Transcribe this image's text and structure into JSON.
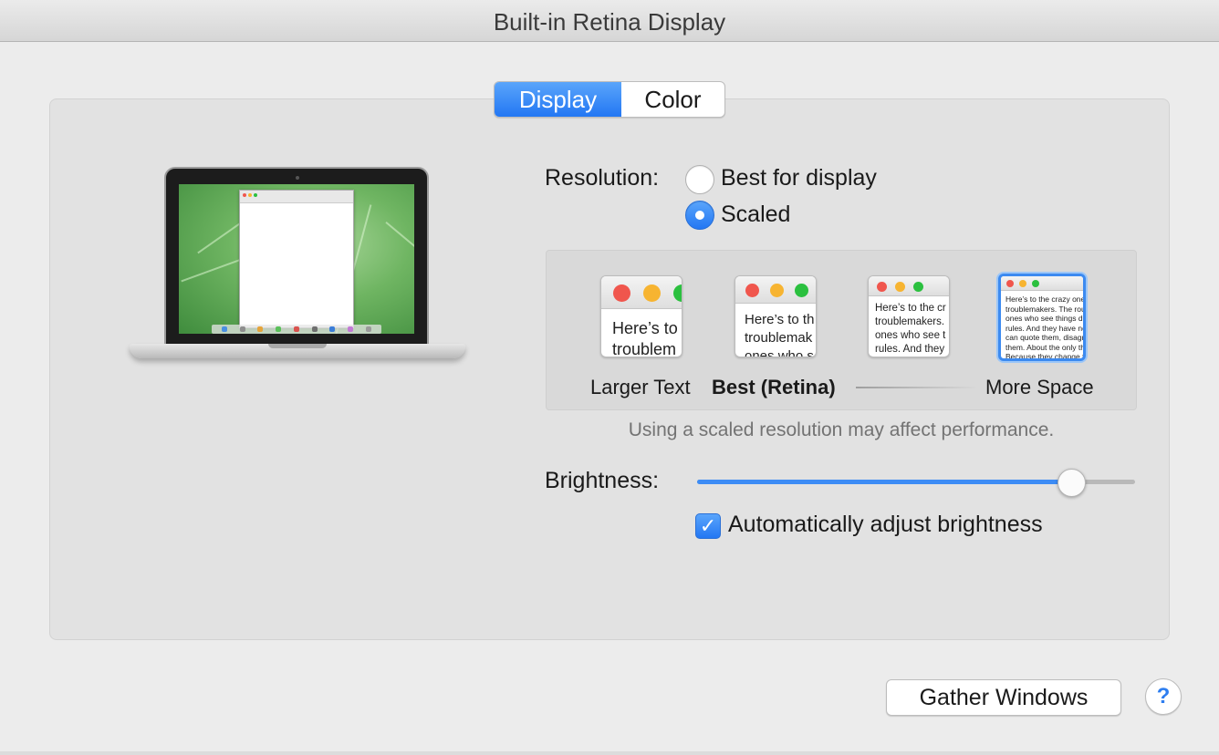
{
  "window": {
    "title": "Built-in Retina Display"
  },
  "tabs": [
    {
      "label": "Display",
      "active": true
    },
    {
      "label": "Color",
      "active": false
    }
  ],
  "resolution": {
    "label": "Resolution:",
    "options": [
      {
        "label": "Best for display",
        "selected": false
      },
      {
        "label": "Scaled",
        "selected": true
      }
    ]
  },
  "scaled_options": {
    "thumbnails": [
      {
        "text": "Here’s to t\ntroublem",
        "selected": false
      },
      {
        "text": "Here’s to th\ntroublemak\nones who s",
        "selected": false
      },
      {
        "text": "Here’s to the cr\ntroublemakers.\nones who see t\nrules. And they",
        "selected": false
      },
      {
        "text": "Here’s to the crazy one\ntroublemakers. The rou\nones who see things di\nrules. And they have no\ncan quote them, disagr\nthem. About the only th\nBecause they change t",
        "selected": true
      }
    ],
    "labels": {
      "larger_text": "Larger Text",
      "best_retina": "Best (Retina)",
      "more_space": "More Space"
    }
  },
  "performance_note": "Using a scaled resolution may affect performance.",
  "brightness": {
    "label": "Brightness:",
    "value": 0.855
  },
  "auto_brightness": {
    "label": "Automatically adjust brightness",
    "checked": true,
    "checkmark": "✓"
  },
  "buttons": {
    "gather_windows": "Gather Windows",
    "help": "?"
  },
  "colors": {
    "accent": "#2377f3",
    "traffic_red": "#f0564d",
    "traffic_yellow": "#f7b431",
    "traffic_green": "#2bc03f"
  }
}
